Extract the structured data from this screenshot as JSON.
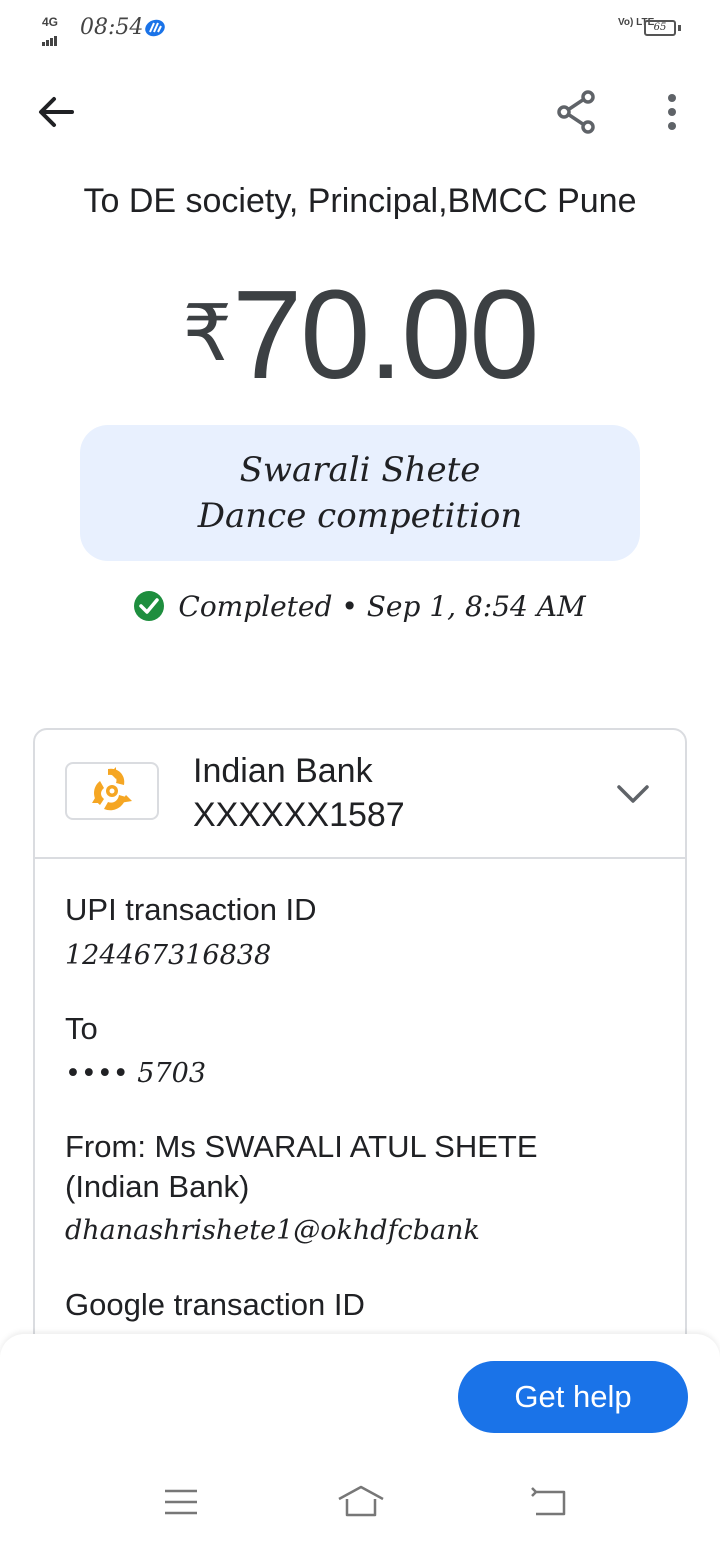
{
  "status_bar": {
    "network": "4G",
    "time": "08:54",
    "volte": "Vo) LTE",
    "battery": "65"
  },
  "header": {
    "back_icon": "arrow-left-icon",
    "share_icon": "share-icon",
    "more_icon": "more-vert-icon"
  },
  "payment": {
    "recipient": "To DE society, Principal,BMCC Pune",
    "currency": "₹",
    "amount": "70.00",
    "note": "Swarali Shete Dance competition",
    "status": "Completed",
    "separator": "•",
    "datetime": "Sep 1, 8:54 AM"
  },
  "account": {
    "bank_name": "Indian Bank",
    "account_number": "XXXXXX1587"
  },
  "details": {
    "upi_label": "UPI transaction ID",
    "upi_value": "124467316838",
    "to_label": "To",
    "to_value": "•••• 5703",
    "from_label_line1": "From: Ms SWARALI ATUL SHETE",
    "from_label_line2": "(Indian Bank)",
    "from_value": "dhanashrishete1@okhdfcbank",
    "google_label": "Google transaction ID"
  },
  "actions": {
    "help": "Get help"
  },
  "colors": {
    "accent": "#1a73e8",
    "success": "#1e8e3e",
    "note_bg": "#e8f0fe",
    "logo": "#f5a623"
  }
}
